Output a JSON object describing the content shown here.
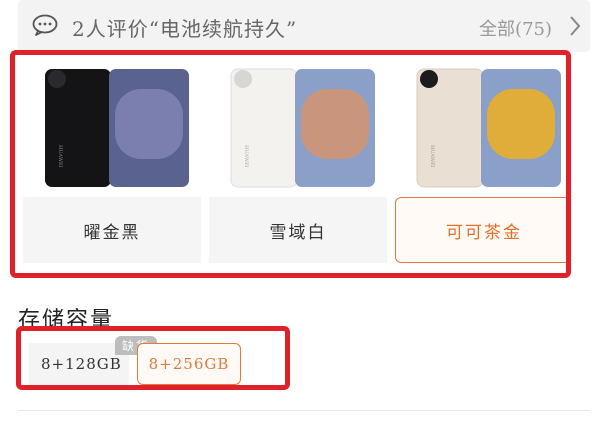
{
  "review": {
    "icon": "chat-bubble-icon",
    "text": "2人评价“电池续航持久”",
    "count_label": "全部(75)",
    "chevron": "chevron-right-icon"
  },
  "colors": [
    {
      "label": "曜金黑",
      "body_color": "#1c1c1e",
      "lens_color": "#6b6e9a",
      "selected": false
    },
    {
      "label": "雪域白",
      "body_color": "#f4f2ef",
      "lens_color": "#c9957c",
      "selected": false
    },
    {
      "label": "可可茶金",
      "body_color": "#e9dfd2",
      "lens_color": "#e0ad3a",
      "selected": true
    }
  ],
  "storage": {
    "title": "存储容量",
    "options": [
      {
        "label": "8+128GB",
        "badge": "缺货",
        "selected": false,
        "disabled": true
      },
      {
        "label": "8+256GB",
        "selected": true,
        "disabled": false
      }
    ]
  },
  "accent": "#e07a3f",
  "highlight_border": "#e0212a"
}
